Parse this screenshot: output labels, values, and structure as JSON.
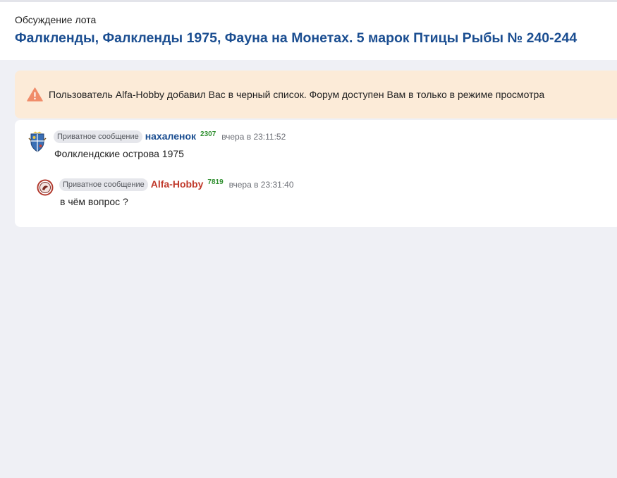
{
  "header": {
    "subtitle": "Обсуждение лота",
    "lot_title": "Фалкленды, Фалкленды 1975, Фауна на Монетах. 5 марок Птицы Рыбы № 240-244"
  },
  "alert": {
    "icon": "warning-triangle-icon",
    "icon_color": "#f08c6a",
    "background": "#fcebd8",
    "text": "Пользователь Alfa-Hobby добавил Вас в черный список. Форум доступен Вам в только в режиме просмотра"
  },
  "messages": [
    {
      "badge": "Приватное сообщение",
      "author": "нахаленок",
      "author_color": "#1b4e91",
      "rating": "2307",
      "timestamp": "вчера в 23:11:52",
      "text": "Фолклендские острова 1975",
      "avatar": "coat-of-arms-avatar"
    },
    {
      "badge": "Приватное сообщение",
      "author": "Alfa-Hobby",
      "author_color": "#c0392b",
      "rating": "7819",
      "timestamp": "вчера в 23:31:40",
      "text": "в чём вопрос ?",
      "avatar": "round-logo-avatar"
    }
  ]
}
